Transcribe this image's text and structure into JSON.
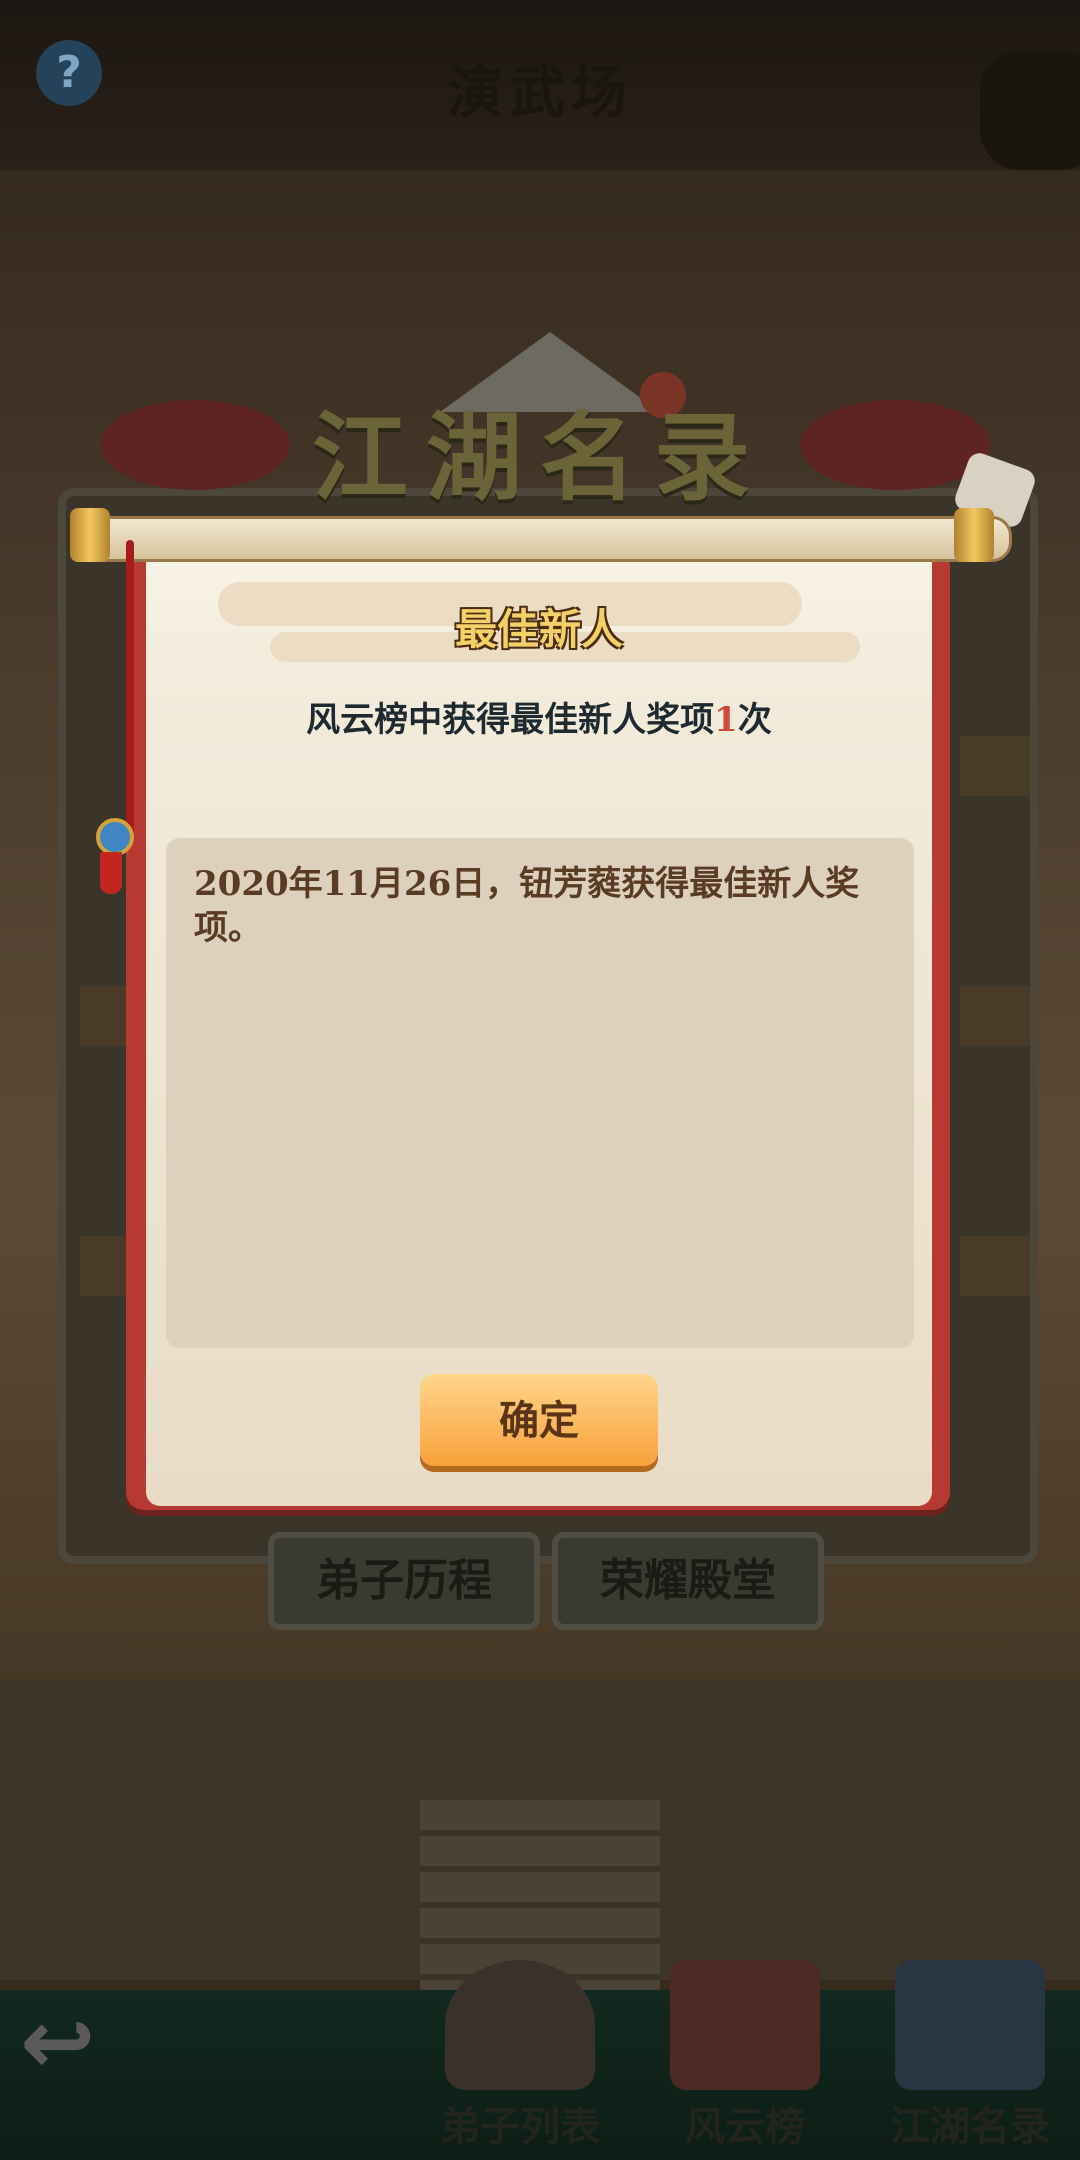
{
  "scene": {
    "title": "演武场",
    "help_icon": "?"
  },
  "banner": {
    "title": "江湖名录"
  },
  "tabs": {
    "history": "弟子历程",
    "hall_of_fame": "荣耀殿堂"
  },
  "dialog": {
    "award_title": "最佳新人",
    "summary_prefix": "风云榜中获得最佳新人奖项",
    "summary_count": "1",
    "summary_suffix": "次",
    "record": "2020年11月26日，钮芳蕤获得最佳新人奖项。",
    "confirm_label": "确定"
  },
  "bottom_nav": {
    "disciples": "弟子列表",
    "fengyun": "风云榜",
    "jianghu": "江湖名录",
    "back_icon": "back-arrow-icon"
  },
  "colors": {
    "scroll_red": "#b63a33",
    "button_orange": "#f8a13a",
    "count_red": "#d04a3a"
  }
}
